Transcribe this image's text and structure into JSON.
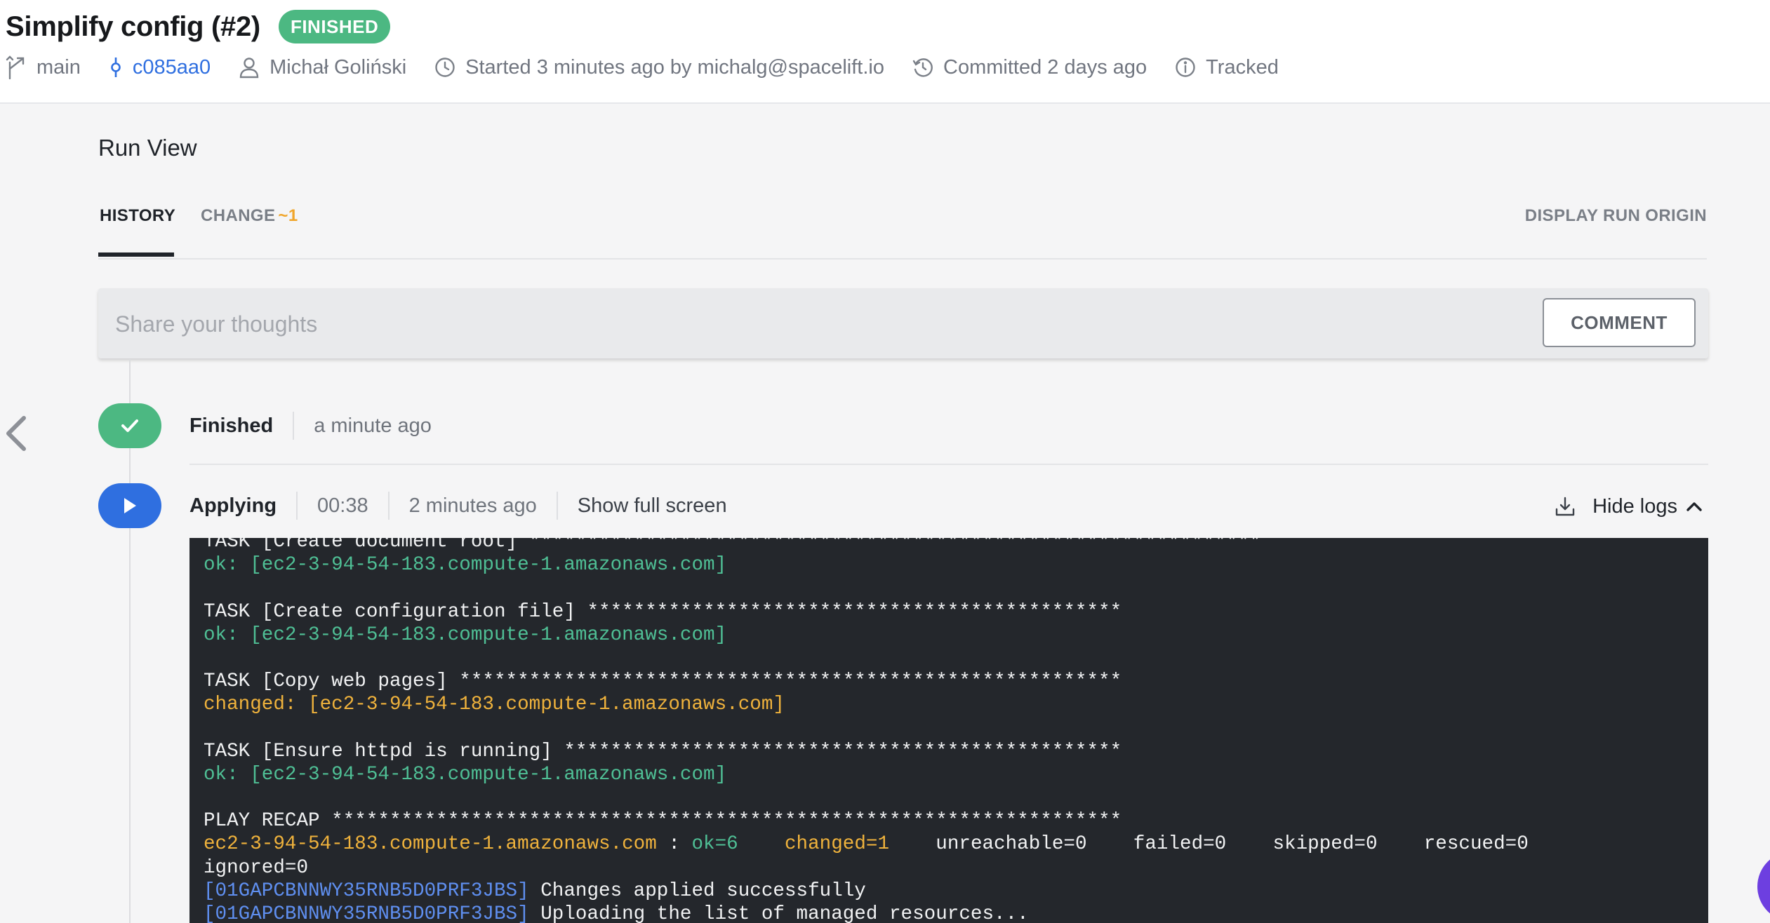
{
  "header": {
    "title": "Simplify config (#2)",
    "status_badge": "FINISHED",
    "branch": "main",
    "commit": "c085aa0",
    "author": "Michał Goliński",
    "started": "Started 3 minutes ago by michalg@spacelift.io",
    "committed": "Committed 2 days ago",
    "tracked": "Tracked"
  },
  "run_view": {
    "title": "Run View",
    "tabs": {
      "history": "HISTORY",
      "change": "CHANGE",
      "change_count": "~1",
      "display_origin": "DISPLAY RUN ORIGIN"
    },
    "comment": {
      "placeholder": "Share your thoughts",
      "button": "COMMENT"
    }
  },
  "timeline": {
    "finished": {
      "label": "Finished",
      "time": "a minute ago"
    },
    "applying": {
      "label": "Applying",
      "duration": "00:38",
      "time": "2 minutes ago",
      "full_screen": "Show full screen",
      "hide_logs": "Hide logs"
    }
  },
  "colors": {
    "finished_badge": "#4cb882",
    "applying_icon": "#2f6fe0",
    "log_background": "#24272c",
    "log_ok": "#4fbf95",
    "log_changed": "#efb23c",
    "log_run_id": "#5f8ff0",
    "change_count": "#f0a52a"
  },
  "logs": [
    [
      {
        "t": "TASK [Create document root] ***************************************************************",
        "c": "white"
      }
    ],
    [
      {
        "t": "ok: [ec2-3-94-54-183.compute-1.amazonaws.com]",
        "c": "green"
      }
    ],
    [],
    [
      {
        "t": "TASK [Create configuration file] **********************************************",
        "c": "white"
      }
    ],
    [
      {
        "t": "ok: [ec2-3-94-54-183.compute-1.amazonaws.com]",
        "c": "green"
      }
    ],
    [],
    [
      {
        "t": "TASK [Copy web pages] *********************************************************",
        "c": "white"
      }
    ],
    [
      {
        "t": "changed: [ec2-3-94-54-183.compute-1.amazonaws.com]",
        "c": "yellow"
      }
    ],
    [],
    [
      {
        "t": "TASK [Ensure httpd is running] ************************************************",
        "c": "white"
      }
    ],
    [
      {
        "t": "ok: [ec2-3-94-54-183.compute-1.amazonaws.com]",
        "c": "green"
      }
    ],
    [],
    [
      {
        "t": "PLAY RECAP ********************************************************************",
        "c": "white"
      }
    ],
    [
      {
        "t": "ec2-3-94-54-183.compute-1.amazonaws.com",
        "c": "yellow"
      },
      {
        "t": " : ",
        "c": "white"
      },
      {
        "t": "ok=6",
        "c": "green"
      },
      {
        "t": "    ",
        "c": "white"
      },
      {
        "t": "changed=1",
        "c": "yellow"
      },
      {
        "t": "    unreachable=0    failed=0    skipped=0    rescued=0",
        "c": "white"
      }
    ],
    [
      {
        "t": "ignored=0",
        "c": "white"
      }
    ],
    [
      {
        "t": "[01GAPCBNNWY35RNB5D0PRF3JBS]",
        "c": "blue"
      },
      {
        "t": " Changes applied successfully",
        "c": "white"
      }
    ],
    [
      {
        "t": "[01GAPCBNNWY35RNB5D0PRF3JBS]",
        "c": "blue"
      },
      {
        "t": " Uploading the list of managed resources...",
        "c": "white"
      }
    ]
  ]
}
